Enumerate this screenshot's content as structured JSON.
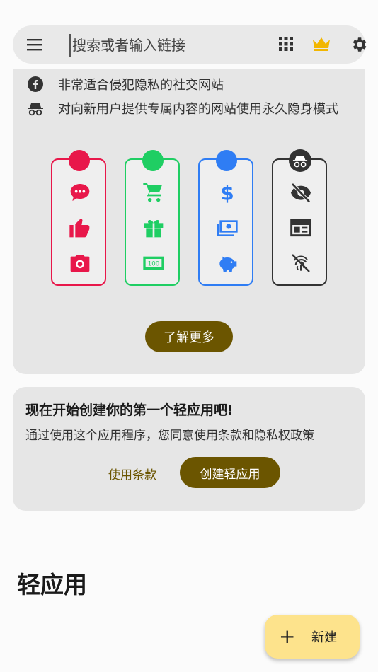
{
  "search": {
    "placeholder": "搜索或者输入链接"
  },
  "features": [
    {
      "icon": "facebook-icon",
      "text": "非常适合侵犯隐私的社交网站"
    },
    {
      "icon": "incognito-icon",
      "text": "对向新用户提供专属内容的网站使用永久隐身模式"
    }
  ],
  "panels": [
    {
      "color": "#e8174a",
      "icons": [
        "chat-bubble-icon",
        "thumbs-up-icon",
        "camera-icon"
      ]
    },
    {
      "color": "#1fce63",
      "icons": [
        "shopping-cart-icon",
        "gift-icon",
        "money-bill-icon"
      ]
    },
    {
      "color": "#2f7df4",
      "icons": [
        "dollar-icon",
        "cash-icon",
        "piggy-bank-icon"
      ]
    },
    {
      "color": "#333333",
      "icons": [
        "incognito-icon",
        "eye-off-icon",
        "web-layout-icon",
        "fingerprint-off-icon"
      ]
    }
  ],
  "learn_more_label": "了解更多",
  "onboarding": {
    "title": "现在开始创建你的第一个轻应用吧!",
    "description": "通过使用这个应用程序，您同意使用条款和隐私权政策",
    "terms_label": "使用条款",
    "create_label": "创建轻应用"
  },
  "section_title": "轻应用",
  "fab": {
    "label": "新建",
    "icon": "plus-icon"
  },
  "colors": {
    "accent": "#6b5500",
    "fab": "#fde38c",
    "card": "#e6e6e6"
  }
}
